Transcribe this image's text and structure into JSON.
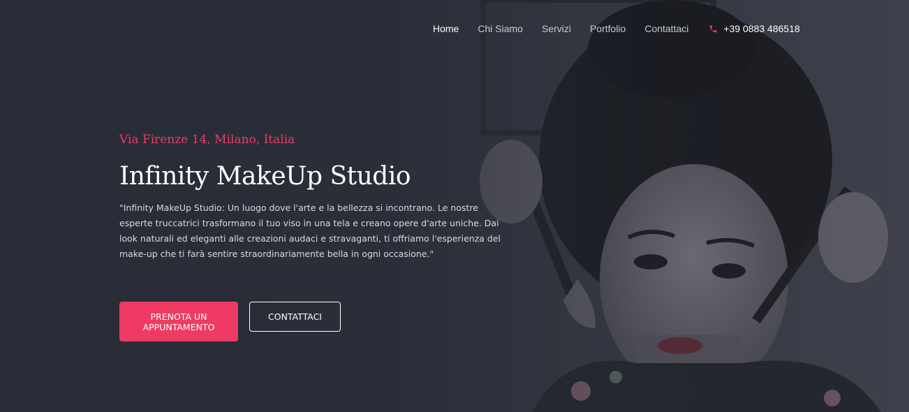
{
  "nav": {
    "items": [
      {
        "label": "Home",
        "active": true
      },
      {
        "label": "Chi Siamo",
        "active": false
      },
      {
        "label": "Servizi",
        "active": false
      },
      {
        "label": "Portfolio",
        "active": false
      },
      {
        "label": "Contattaci",
        "active": false
      }
    ],
    "phone": "+39 0883 486518",
    "phone_icon": "phone-icon"
  },
  "hero": {
    "address": "Via Firenze 14, Milano, Italia",
    "title": "Infinity MakeUp Studio",
    "description": "\"Infinity MakeUp Studio: Un luogo dove l'arte e la bellezza si incontrano. Le nostre esperte truccatrici trasformano il tuo viso in una tela e creano opere d'arte uniche. Dai look naturali ed eleganti alle creazioni audaci e stravaganti, ti offriamo l'esperienza del make-up che ti farà sentire straordinariamente bella in ogni occasione.\"",
    "primary_button": "PRENOTA UN APPUNTAMENTO",
    "secondary_button": "CONTATTACI"
  },
  "colors": {
    "accent": "#ef3b63",
    "background": "#2d323e",
    "text": "#ffffff"
  }
}
